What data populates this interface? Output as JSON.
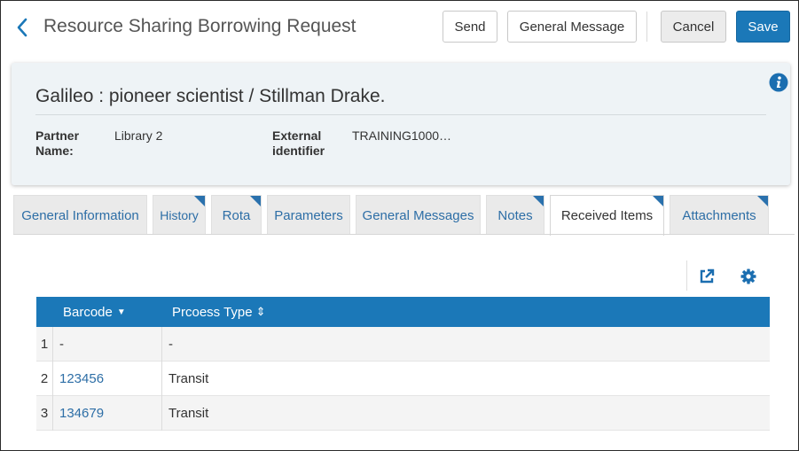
{
  "header": {
    "title": "Resource Sharing Borrowing Request",
    "back_icon": "chevron-left-icon",
    "buttons": {
      "send": "Send",
      "general_message": "General Message",
      "cancel": "Cancel",
      "save": "Save"
    }
  },
  "summary": {
    "title": "Galileo : pioneer scientist / Stillman Drake.",
    "fields": {
      "partner_label_1": "Partner",
      "partner_label_2": "Name:",
      "partner_value": "Library 2",
      "external_label_1": "External",
      "external_label_2": "identifier",
      "external_value": "TRAINING1000…"
    },
    "info_icon": "info-icon"
  },
  "tabs": [
    {
      "label": "General Information",
      "active": false,
      "corner": false
    },
    {
      "label": "History",
      "active": false,
      "corner": true
    },
    {
      "label": "Rota",
      "active": false,
      "corner": true
    },
    {
      "label": "Parameters",
      "active": false,
      "corner": false
    },
    {
      "label": "General Messages",
      "active": false,
      "corner": false
    },
    {
      "label": "Notes",
      "active": false,
      "corner": true
    },
    {
      "label": "Received Items",
      "active": true,
      "corner": true
    },
    {
      "label": "Attachments",
      "active": false,
      "corner": true
    }
  ],
  "toolbar": {
    "export_icon": "export-icon",
    "settings_icon": "gear-icon"
  },
  "table": {
    "columns": {
      "barcode": "Barcode",
      "barcode_sort": "▼",
      "process_type": "Prcoess Type",
      "process_sort": "⇕"
    },
    "rows": [
      {
        "num": "1",
        "barcode": "-",
        "process_type": "-"
      },
      {
        "num": "2",
        "barcode": "123456",
        "process_type": "Transit"
      },
      {
        "num": "3",
        "barcode": "134679",
        "process_type": "Transit"
      }
    ]
  },
  "colors": {
    "primary": "#1b78b8",
    "link": "#2d6ea6",
    "card_bg": "#eef3f6",
    "tab_corner": "#2a71ad"
  }
}
